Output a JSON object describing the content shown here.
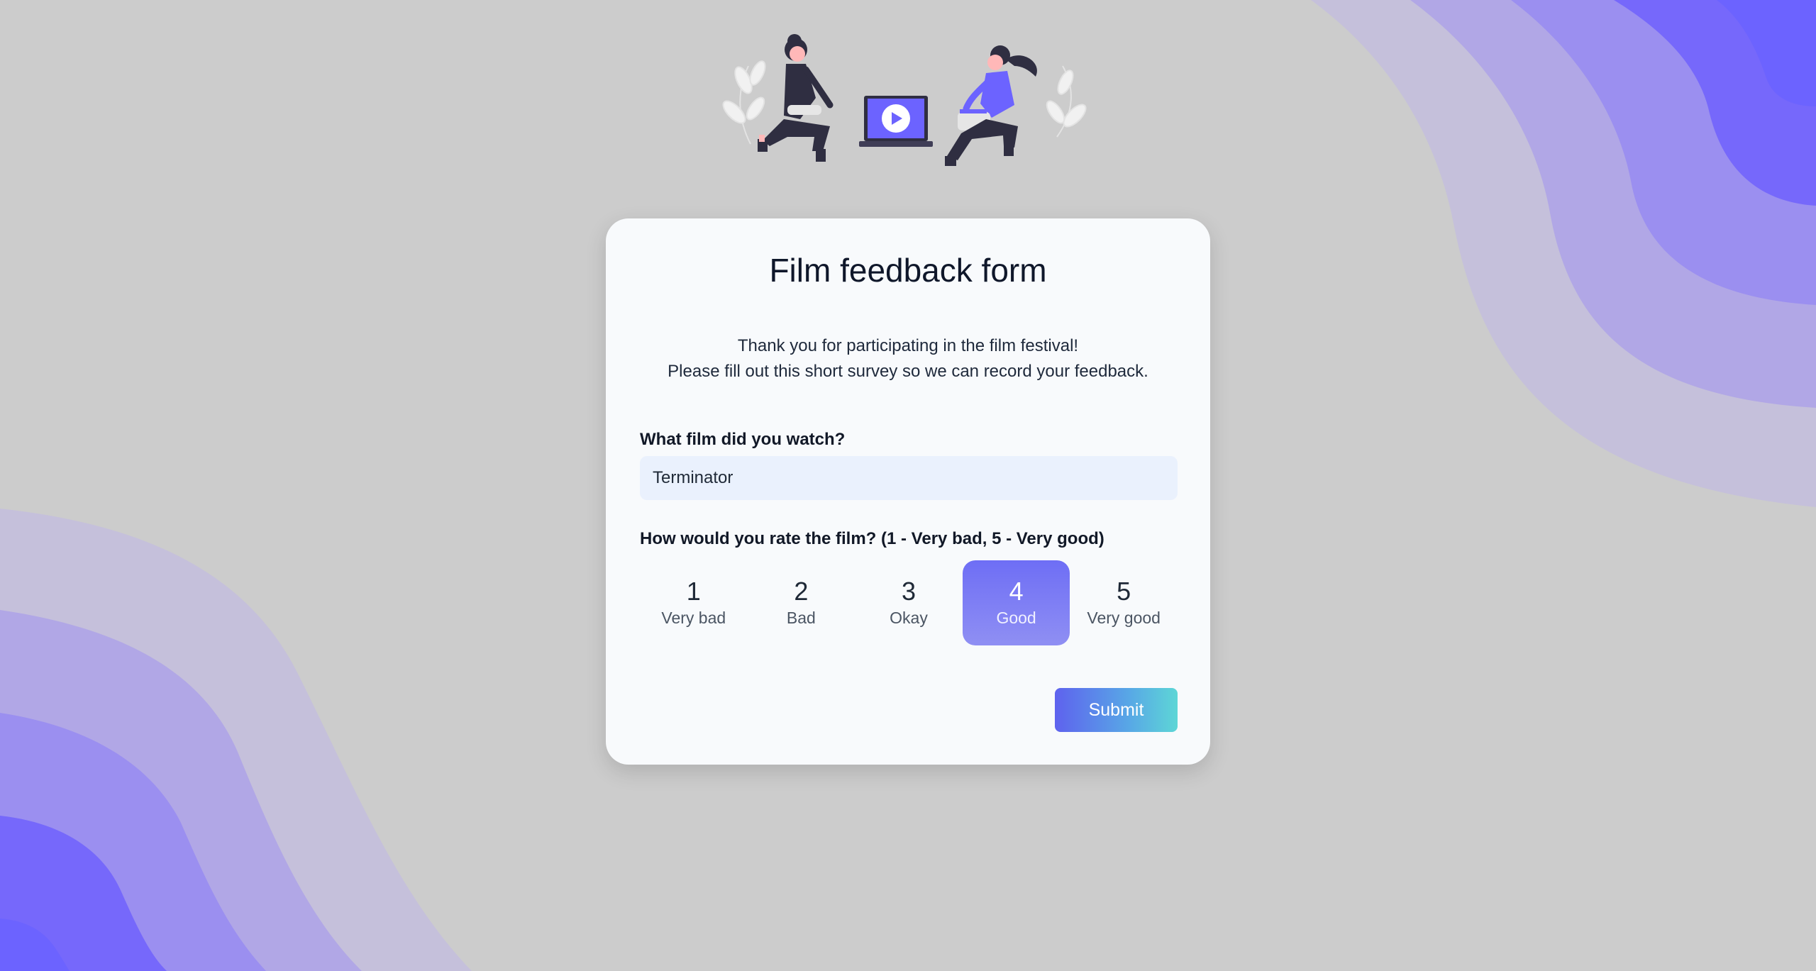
{
  "form": {
    "title": "Film feedback form",
    "intro_line1": "Thank you for participating in the film festival!",
    "intro_line2": "Please fill out this short survey so we can record your feedback.",
    "film_question": "What film did you watch?",
    "film_value": "Terminator",
    "rating_question": "How would you rate the film? (1 - Very bad, 5 - Very good)",
    "ratings": [
      {
        "value": "1",
        "label": "Very bad"
      },
      {
        "value": "2",
        "label": "Bad"
      },
      {
        "value": "3",
        "label": "Okay"
      },
      {
        "value": "4",
        "label": "Good"
      },
      {
        "value": "5",
        "label": "Very good"
      }
    ],
    "selected_rating": "4",
    "submit_label": "Submit"
  },
  "colors": {
    "page_background": "#cccccc",
    "accent": "#6c63ff",
    "wave_light": "#c5c0db",
    "wave_mid": "#b1a7e6",
    "wave_strong": "#9b8ff0",
    "wave_deep": "#7668fb"
  }
}
